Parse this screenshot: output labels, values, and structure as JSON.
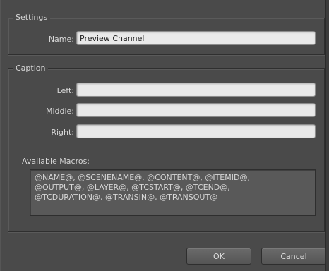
{
  "settings": {
    "title": "Settings",
    "name_label": "Name:",
    "name_value": "Preview Channel"
  },
  "caption": {
    "title": "Caption",
    "left_label": "Left:",
    "left_value": "",
    "middle_label": "Middle:",
    "middle_value": "",
    "right_label": "Right:",
    "right_value": "",
    "macros_label": "Available Macros:",
    "macros_text": "@NAME@, @SCENENAME@, @CONTENT@, @ITEMID@,\n@OUTPUT@, @LAYER@, @TCSTART@, @TCEND@,\n@TCDURATION@, @TRANSIN@, @TRANSOUT@"
  },
  "buttons": {
    "ok_mnemonic": "O",
    "ok_rest": "K",
    "cancel_mnemonic": "C",
    "cancel_rest": "ancel"
  },
  "colors": {
    "background": "#4a4a4a",
    "field": "#e9e9e9",
    "text": "#d6d6d6"
  }
}
